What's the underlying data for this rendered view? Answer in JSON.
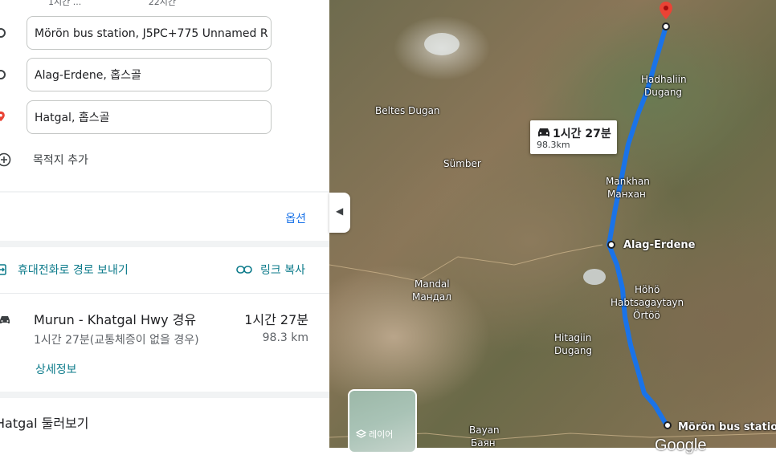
{
  "panel": {
    "top_cut_left": "1시간 ...",
    "top_cut_right": "22시간",
    "waypoints": [
      {
        "value": "Mörön bus station, J5PC+775 Unnamed R"
      },
      {
        "value": "Alag-Erdene, 홉스골"
      },
      {
        "value": "Hatgal, 홉스골"
      }
    ],
    "add_destination": "목적지 추가",
    "options": "옵션",
    "send_to_phone": "휴대전화로 경로 보내기",
    "copy_link": "링크 복사",
    "route": {
      "title": "Murun - Khatgal Hwy 경유",
      "duration": "1시간 27분",
      "subtitle": "1시간 27분(교통체증이 없을 경우)",
      "distance": "98.3 km",
      "details": "상세정보"
    },
    "explore": "Hatgal 둘러보기"
  },
  "map": {
    "labels": {
      "hadhaliin_1": "Hadhaliin",
      "hadhaliin_2": "Dugang",
      "beltes": "Beltes Dugan",
      "sumber": "Sümber",
      "mankhan_1": "Mankhan",
      "mankhan_2": "Манхан",
      "alag": "Alag-Erdene",
      "mandal_1": "Mandal",
      "mandal_2": "Мандал",
      "hoho_1": "Höhö",
      "hoho_2": "Habtsagaytayn",
      "hoho_3": "Örtöö",
      "hitagiin_1": "Hitagiin",
      "hitagiin_2": "Dugang",
      "bayan_1": "Bayan",
      "bayan_2": "Баян",
      "moron": "Mörön bus station"
    },
    "callout_time": "1시간 27분",
    "callout_distance": "98.3km",
    "layer_label": "레이어",
    "google": "Google",
    "route_color": "#1a73e8"
  }
}
